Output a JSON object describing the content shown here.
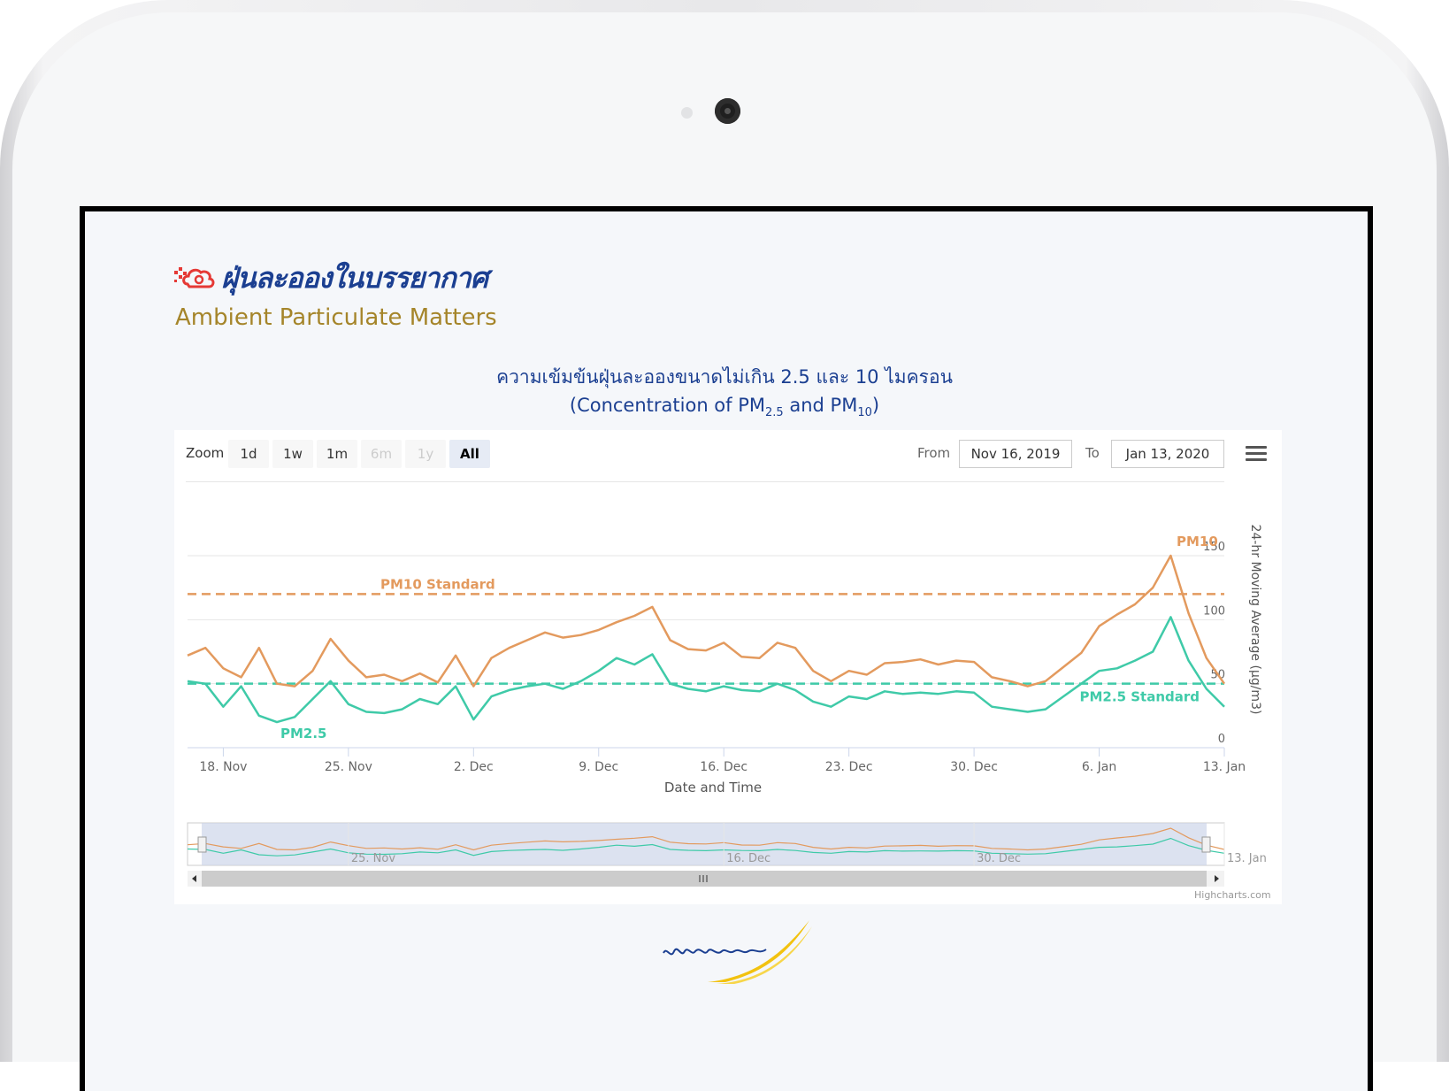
{
  "brand": {
    "thai_title": "ฝุ่นละอองในบรรยากาศ",
    "english_title": "Ambient Particulate Matters"
  },
  "chart_title": {
    "thai": "ความเข้มข้นฝุ่นละอองขนาดไม่เกิน 2.5 และ 10 ไมครอน",
    "en_prefix": "(Concentration of PM",
    "en_sub1": "2.5",
    "en_mid": " and PM",
    "en_sub2": "10",
    "en_suffix": ")"
  },
  "toolbar": {
    "zoom_label": "Zoom",
    "zoom_buttons": [
      {
        "label": "1d",
        "state": "normal"
      },
      {
        "label": "1w",
        "state": "normal"
      },
      {
        "label": "1m",
        "state": "normal"
      },
      {
        "label": "6m",
        "state": "disabled"
      },
      {
        "label": "1y",
        "state": "disabled"
      },
      {
        "label": "All",
        "state": "active"
      }
    ],
    "from_label": "From",
    "from_value": "Nov 16, 2019",
    "to_label": "To",
    "to_value": "Jan 13, 2020",
    "menu_icon": "hamburger-menu-icon"
  },
  "credits": "Highcharts.com",
  "colors": {
    "pm10": "#e39a5e",
    "pm25": "#3fcaa8",
    "navigator_mask": "#cdd5ea"
  },
  "chart_data": {
    "type": "line",
    "xlabel": "Date and Time",
    "ylabel": "24-hr Moving Average (μg/m3)",
    "x_range": [
      "2019-11-16",
      "2020-01-13"
    ],
    "ylim": [
      0,
      150
    ],
    "y_ticks": [
      0,
      50,
      100,
      150
    ],
    "x_tick_labels": [
      "18. Nov",
      "25. Nov",
      "2. Dec",
      "9. Dec",
      "16. Dec",
      "23. Dec",
      "30. Dec",
      "6. Jan",
      "13. Jan"
    ],
    "navigator_tick_labels": [
      "25. Nov",
      "16. Dec",
      "30. Dec",
      "13. Jan"
    ],
    "y_axis_side": "right",
    "grid": true,
    "plot_lines": [
      {
        "label": "PM10 Standard",
        "value": 120,
        "color": "#e39a5e"
      },
      {
        "label": "PM2.5 Standard",
        "value": 50,
        "color": "#3fcaa8"
      }
    ],
    "series": [
      {
        "name": "PM10",
        "color": "#e39a5e",
        "x": [
          "2019-11-16",
          "2019-11-17",
          "2019-11-18",
          "2019-11-19",
          "2019-11-20",
          "2019-11-21",
          "2019-11-22",
          "2019-11-23",
          "2019-11-24",
          "2019-11-25",
          "2019-11-26",
          "2019-11-27",
          "2019-11-28",
          "2019-11-29",
          "2019-11-30",
          "2019-12-01",
          "2019-12-02",
          "2019-12-03",
          "2019-12-04",
          "2019-12-05",
          "2019-12-06",
          "2019-12-07",
          "2019-12-08",
          "2019-12-09",
          "2019-12-10",
          "2019-12-11",
          "2019-12-12",
          "2019-12-13",
          "2019-12-14",
          "2019-12-15",
          "2019-12-16",
          "2019-12-17",
          "2019-12-18",
          "2019-12-19",
          "2019-12-20",
          "2019-12-21",
          "2019-12-22",
          "2019-12-23",
          "2019-12-24",
          "2019-12-25",
          "2019-12-26",
          "2019-12-27",
          "2019-12-28",
          "2019-12-29",
          "2019-12-30",
          "2019-12-31",
          "2020-01-01",
          "2020-01-02",
          "2020-01-03",
          "2020-01-04",
          "2020-01-05",
          "2020-01-06",
          "2020-01-07",
          "2020-01-08",
          "2020-01-09",
          "2020-01-10",
          "2020-01-11",
          "2020-01-12",
          "2020-01-13"
        ],
        "values": [
          72,
          78,
          62,
          55,
          78,
          50,
          48,
          60,
          85,
          68,
          55,
          57,
          52,
          58,
          51,
          72,
          48,
          70,
          78,
          84,
          90,
          86,
          88,
          92,
          98,
          103,
          110,
          84,
          77,
          76,
          82,
          71,
          70,
          82,
          78,
          60,
          52,
          60,
          57,
          66,
          67,
          69,
          65,
          68,
          67,
          55,
          52,
          48,
          52,
          63,
          74,
          95,
          104,
          112,
          125,
          150,
          105,
          70,
          50
        ]
      },
      {
        "name": "PM2.5",
        "color": "#3fcaa8",
        "x": [
          "2019-11-16",
          "2019-11-17",
          "2019-11-18",
          "2019-11-19",
          "2019-11-20",
          "2019-11-21",
          "2019-11-22",
          "2019-11-23",
          "2019-11-24",
          "2019-11-25",
          "2019-11-26",
          "2019-11-27",
          "2019-11-28",
          "2019-11-29",
          "2019-11-30",
          "2019-12-01",
          "2019-12-02",
          "2019-12-03",
          "2019-12-04",
          "2019-12-05",
          "2019-12-06",
          "2019-12-07",
          "2019-12-08",
          "2019-12-09",
          "2019-12-10",
          "2019-12-11",
          "2019-12-12",
          "2019-12-13",
          "2019-12-14",
          "2019-12-15",
          "2019-12-16",
          "2019-12-17",
          "2019-12-18",
          "2019-12-19",
          "2019-12-20",
          "2019-12-21",
          "2019-12-22",
          "2019-12-23",
          "2019-12-24",
          "2019-12-25",
          "2019-12-26",
          "2019-12-27",
          "2019-12-28",
          "2019-12-29",
          "2019-12-30",
          "2019-12-31",
          "2020-01-01",
          "2020-01-02",
          "2020-01-03",
          "2020-01-04",
          "2020-01-05",
          "2020-01-06",
          "2020-01-07",
          "2020-01-08",
          "2020-01-09",
          "2020-01-10",
          "2020-01-11",
          "2020-01-12",
          "2020-01-13"
        ],
        "values": [
          52,
          50,
          32,
          48,
          25,
          20,
          24,
          38,
          52,
          34,
          28,
          27,
          30,
          38,
          34,
          48,
          22,
          40,
          45,
          48,
          50,
          46,
          52,
          60,
          70,
          65,
          73,
          50,
          46,
          44,
          48,
          45,
          44,
          50,
          45,
          36,
          32,
          40,
          38,
          44,
          42,
          43,
          42,
          44,
          43,
          32,
          30,
          28,
          30,
          40,
          50,
          60,
          62,
          68,
          75,
          102,
          68,
          46,
          32
        ]
      }
    ]
  }
}
